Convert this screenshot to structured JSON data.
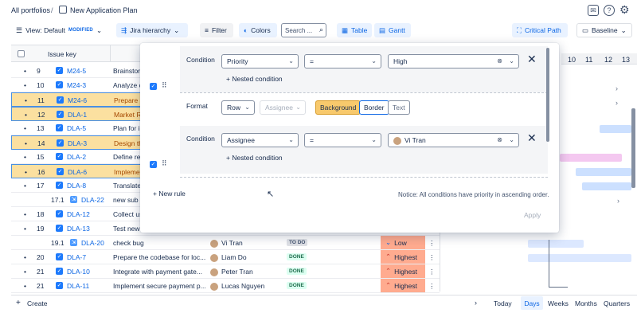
{
  "breadcrumb": {
    "root": "All portfolios",
    "separator": "/",
    "plan": "New Application Plan"
  },
  "toolbar": {
    "view_label": "View: Default",
    "view_tag": "MODIFIED",
    "hierarchy_label": "Jira hierarchy",
    "filter_label": "Filter",
    "colors_label": "Colors",
    "search_placeholder": "Search ...",
    "table_label": "Table",
    "gantt_label": "Gantt",
    "critical_path_label": "Critical Path",
    "baseline_label": "Baseline"
  },
  "grid": {
    "header_issue_key": "Issue key",
    "rows": [
      {
        "num": "9",
        "key": "M24-5",
        "summary": "Brainstorm",
        "highlight": false,
        "type": "story"
      },
      {
        "num": "10",
        "key": "M24-3",
        "summary": "Analyze c",
        "highlight": false,
        "type": "story"
      },
      {
        "num": "11",
        "key": "M24-6",
        "summary": "Prepare e",
        "highlight": true,
        "type": "story"
      },
      {
        "num": "12",
        "key": "DLA-1",
        "summary": "Market Re",
        "highlight": true,
        "type": "story"
      },
      {
        "num": "13",
        "key": "DLA-5",
        "summary": "Plan for in",
        "highlight": false,
        "type": "story"
      },
      {
        "num": "14",
        "key": "DLA-3",
        "summary": "Design the",
        "highlight": true,
        "type": "story"
      },
      {
        "num": "15",
        "key": "DLA-2",
        "summary": "Define re",
        "highlight": false,
        "type": "story"
      },
      {
        "num": "16",
        "key": "DLA-6",
        "summary": "Implemen",
        "highlight": true,
        "type": "story"
      },
      {
        "num": "17",
        "key": "DLA-8",
        "summary": "Translate",
        "highlight": false,
        "type": "story"
      },
      {
        "num": "17.1",
        "key": "DLA-22",
        "summary": "new sub t",
        "highlight": false,
        "type": "subtask"
      },
      {
        "num": "18",
        "key": "DLA-12",
        "summary": "Collect us",
        "highlight": false,
        "type": "story"
      },
      {
        "num": "19",
        "key": "DLA-13",
        "summary": "Test new",
        "highlight": false,
        "type": "story"
      },
      {
        "num": "19.1",
        "key": "DLA-20",
        "summary": "check bug",
        "highlight": false,
        "type": "subtask",
        "assignee": "Vi Tran",
        "status": "TO DO",
        "priority": "Low"
      },
      {
        "num": "20",
        "key": "DLA-7",
        "summary": "Prepare the codebase for loc...",
        "highlight": false,
        "type": "story",
        "assignee": "Liam Do",
        "status": "DONE",
        "priority": "Highest"
      },
      {
        "num": "21",
        "key": "DLA-10",
        "summary": "Integrate with payment gate...",
        "highlight": false,
        "type": "story",
        "assignee": "Peter Tran",
        "status": "DONE",
        "priority": "Highest"
      },
      {
        "num": "21",
        "key": "DLA-11",
        "summary": "Implement secure payment p...",
        "highlight": false,
        "type": "story",
        "assignee": "Lucas Nguyen",
        "status": "DONE",
        "priority": "Highest"
      }
    ]
  },
  "gantt": {
    "dates": [
      "10",
      "11",
      "12",
      "13"
    ]
  },
  "bottom": {
    "create_label": "Create",
    "today_label": "Today",
    "days_label": "Days",
    "weeks_label": "Weeks",
    "months_label": "Months",
    "quarters_label": "Quarters"
  },
  "modal": {
    "rule1": {
      "condition_label": "Condition",
      "field": "Priority",
      "operator": "=",
      "value": "High",
      "nested_label": "Nested condition",
      "format_label": "Format",
      "format_scope": "Row",
      "format_assignee": "Assignee",
      "background_label": "Background",
      "border_label": "Border",
      "text_label": "Text"
    },
    "rule2": {
      "condition_label": "Condition",
      "field": "Assignee",
      "operator": "=",
      "value": "Vi Tran",
      "nested_label": "Nested condition"
    },
    "new_rule_label": "New rule",
    "notice": "Notice: All conditions have priority in ascending order.",
    "apply_label": "Apply"
  },
  "colors": {
    "accent": "#0c66e4",
    "highlight_row": "#fbe0a0",
    "priority_cell": "#ffab8f",
    "background_btn": "#f8c96c"
  }
}
